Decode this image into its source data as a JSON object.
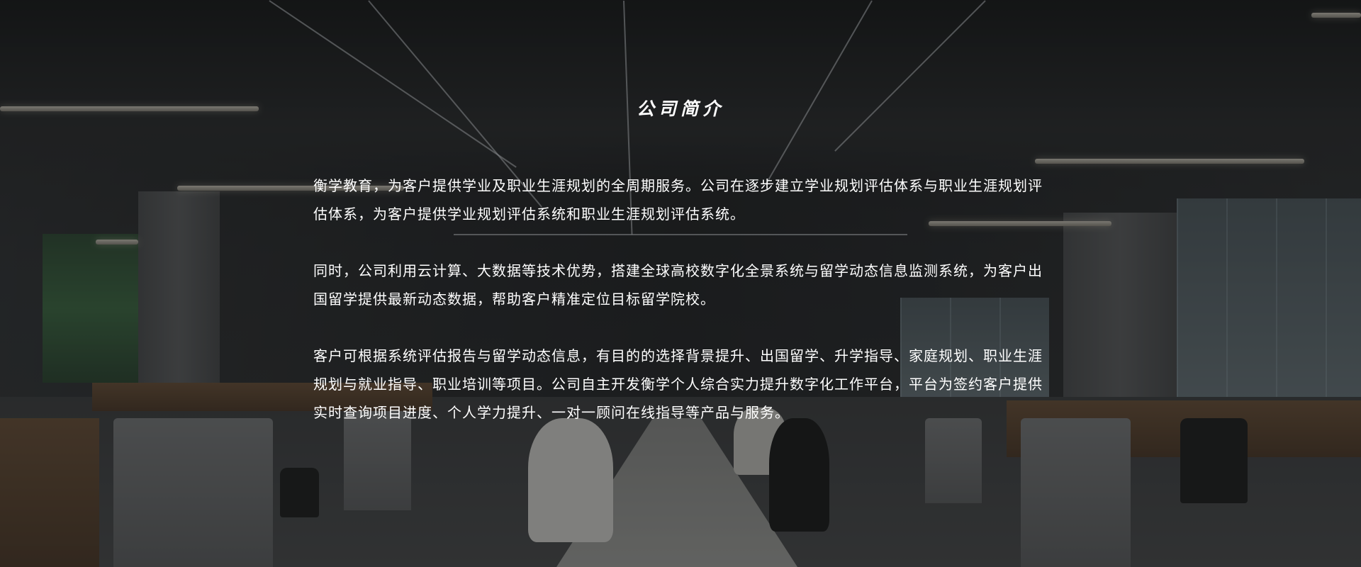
{
  "section": {
    "title": "公司简介",
    "paragraphs": [
      "衡学教育，为客户提供学业及职业生涯规划的全周期服务。公司在逐步建立学业规划评估体系与职业生涯规划评估体系，为客户提供学业规划评估系统和职业生涯规划评估系统。",
      "同时，公司利用云计算、大数据等技术优势，搭建全球高校数字化全景系统与留学动态信息监测系统，为客户出国留学提供最新动态数据，帮助客户精准定位目标留学院校。",
      "客户可根据系统评估报告与留学动态信息，有目的的选择背景提升、出国留学、升学指导、家庭规划、职业生涯规划与就业指导、职业培训等项目。公司自主开发衡学个人综合实力提升数字化工作平台，平台为签约客户提供实时查询项目进度、个人学力提升、一对一顾问在线指导等产品与服务。"
    ]
  },
  "background": {
    "image": "office-interior-background",
    "overlay_color": "#121315"
  }
}
